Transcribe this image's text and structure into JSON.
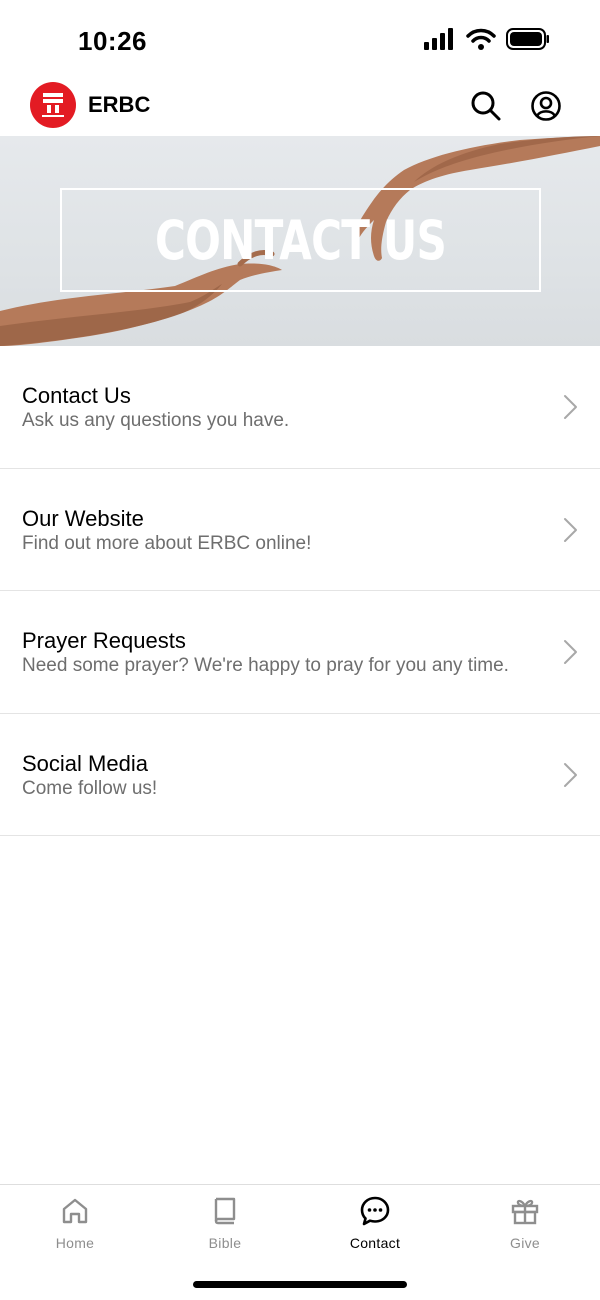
{
  "status_bar": {
    "time": "10:26"
  },
  "header": {
    "app_title": "ERBC",
    "logo_icon": "church-logo-icon"
  },
  "banner": {
    "title": "CONTACT US"
  },
  "list": {
    "items": [
      {
        "title": "Contact Us",
        "subtitle": "Ask us any questions you have."
      },
      {
        "title": "Our Website",
        "subtitle": "Find out more about ERBC online!"
      },
      {
        "title": "Prayer Requests",
        "subtitle": "Need some prayer? We're happy to pray for you any time."
      },
      {
        "title": "Social Media",
        "subtitle": "Come follow us!"
      }
    ]
  },
  "tab_bar": {
    "tabs": [
      {
        "label": "Home",
        "icon": "home-icon",
        "active": false
      },
      {
        "label": "Bible",
        "icon": "book-icon",
        "active": false
      },
      {
        "label": "Contact",
        "icon": "chat-bubble-icon",
        "active": true
      },
      {
        "label": "Give",
        "icon": "gift-icon",
        "active": false
      }
    ]
  },
  "colors": {
    "brand": "#e31b23",
    "inactive": "#8e8e8e",
    "active": "#000000"
  }
}
